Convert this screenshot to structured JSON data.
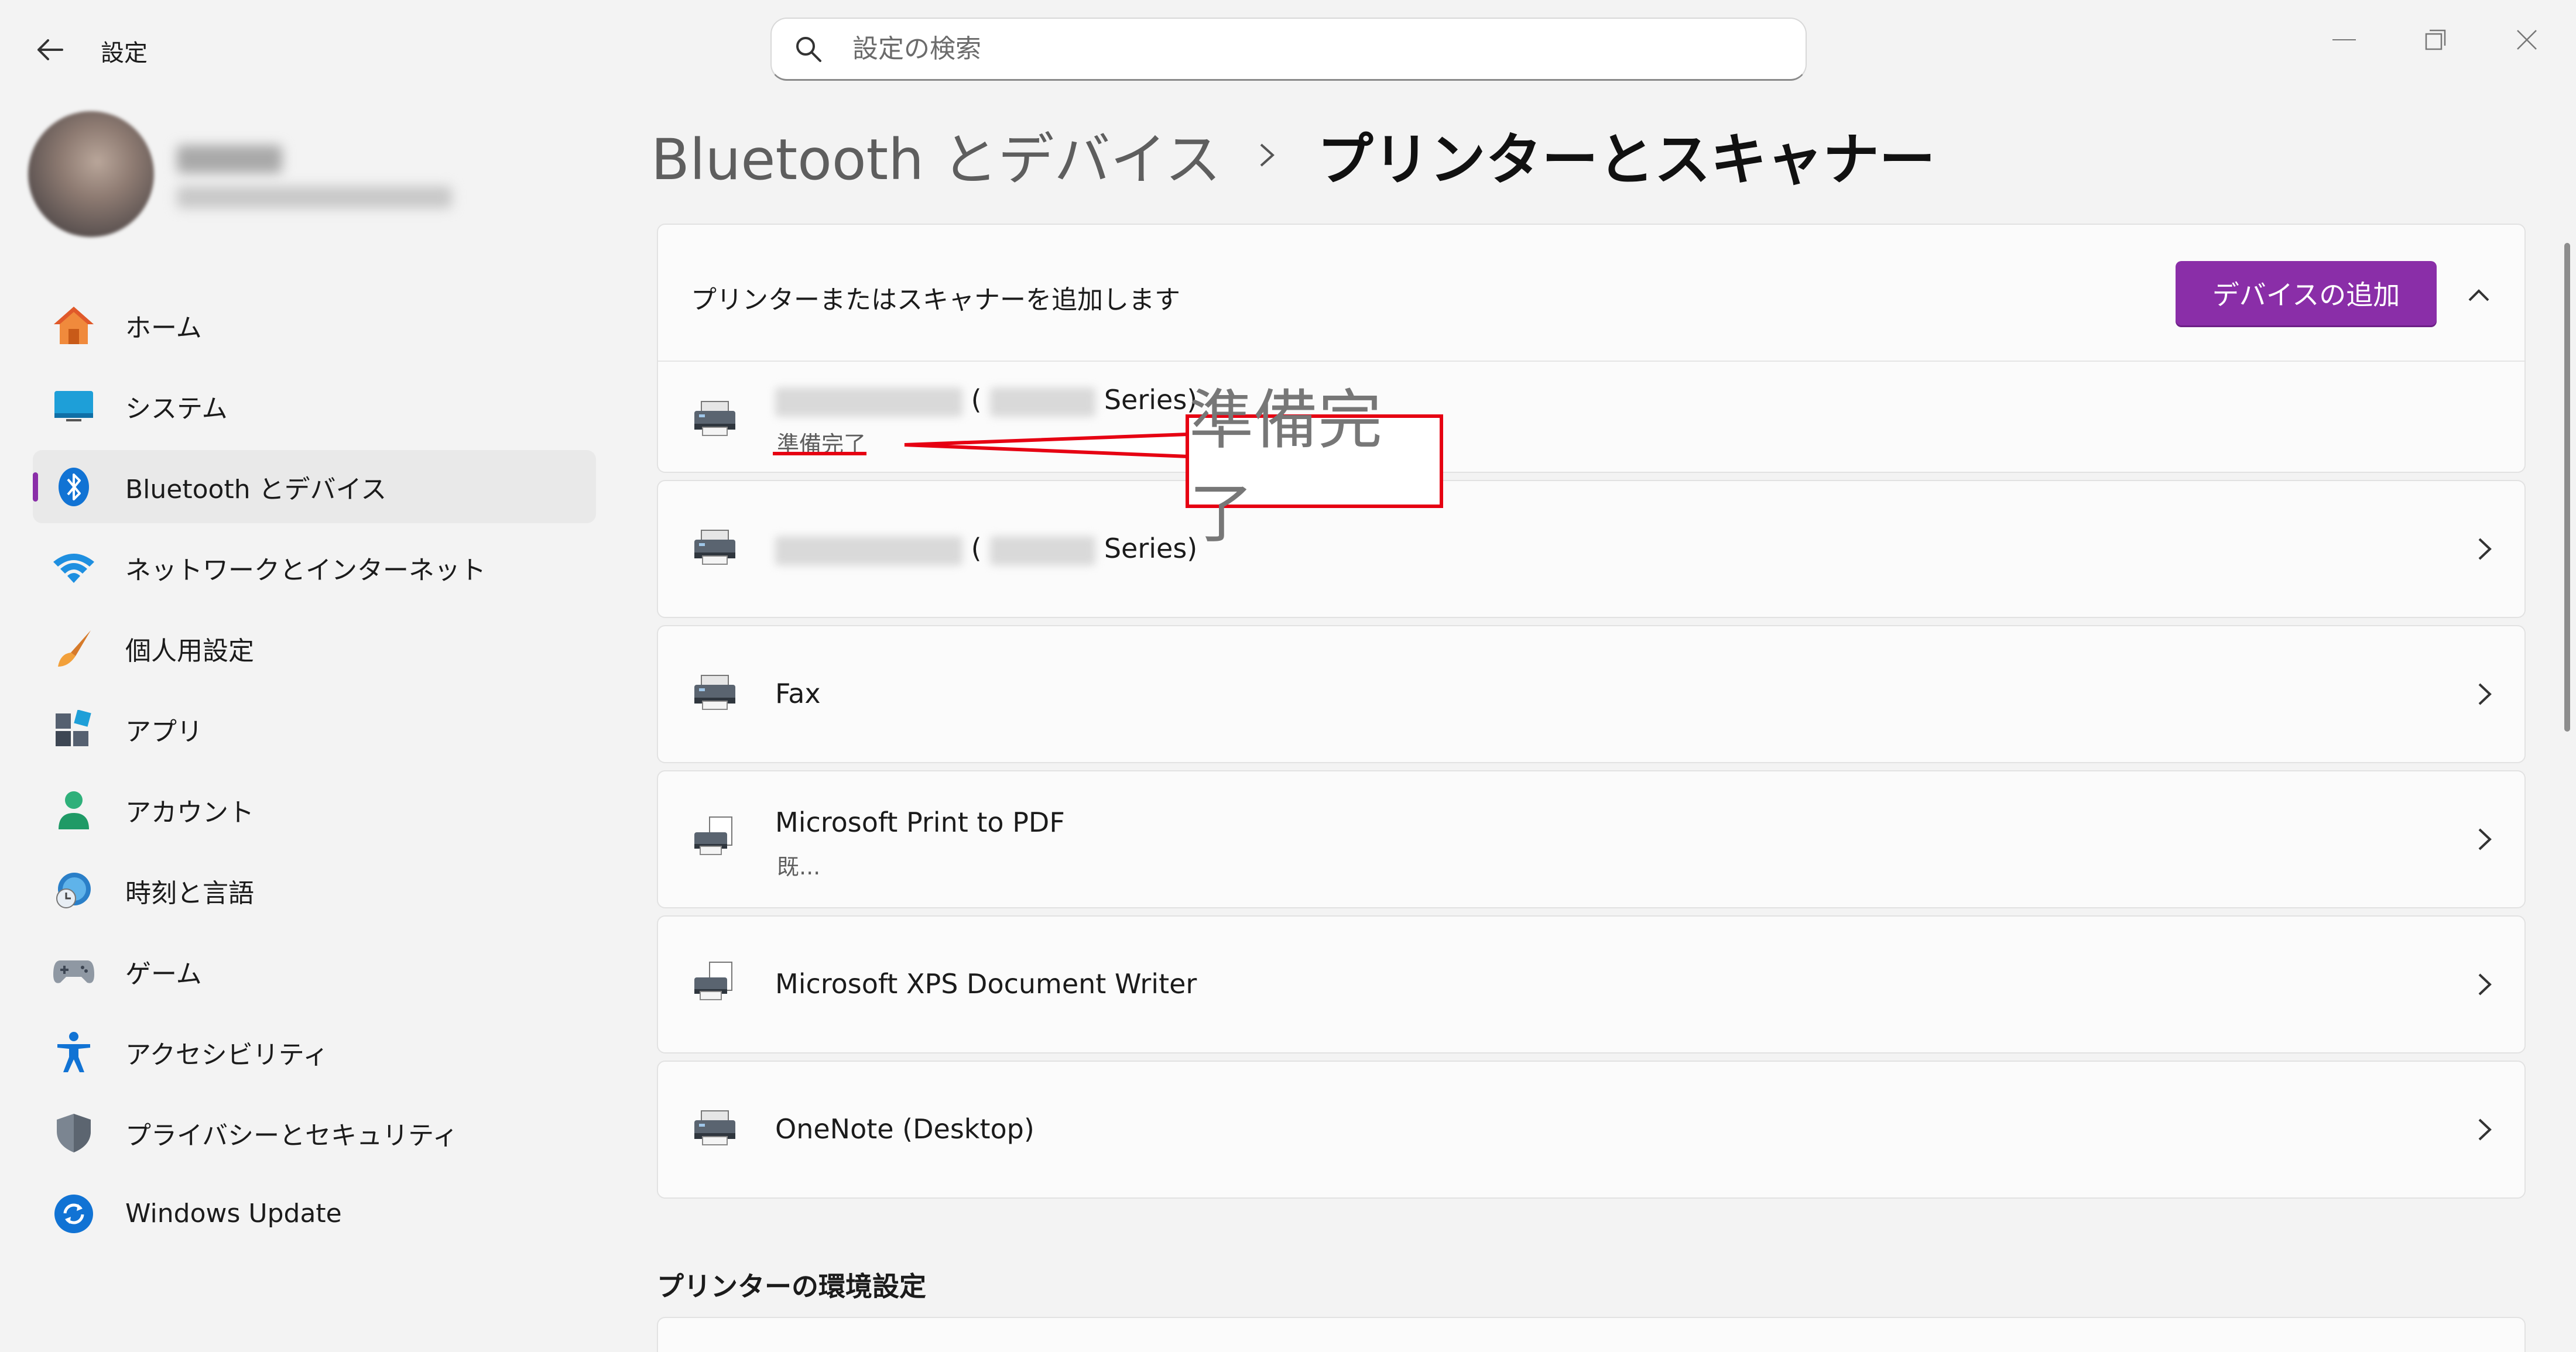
{
  "app": {
    "title": "設定",
    "search_placeholder": "設定の検索"
  },
  "sidebar": {
    "items": [
      {
        "label": "ホーム",
        "icon": "home-icon"
      },
      {
        "label": "システム",
        "icon": "system-icon"
      },
      {
        "label": "Bluetooth とデバイス",
        "icon": "bluetooth-icon",
        "active": true
      },
      {
        "label": "ネットワークとインターネット",
        "icon": "wifi-icon"
      },
      {
        "label": "個人用設定",
        "icon": "brush-icon"
      },
      {
        "label": "アプリ",
        "icon": "apps-icon"
      },
      {
        "label": "アカウント",
        "icon": "account-icon"
      },
      {
        "label": "時刻と言語",
        "icon": "time-language-icon"
      },
      {
        "label": "ゲーム",
        "icon": "gamepad-icon"
      },
      {
        "label": "アクセシビリティ",
        "icon": "accessibility-icon"
      },
      {
        "label": "プライバシーとセキュリティ",
        "icon": "shield-icon"
      },
      {
        "label": "Windows Update",
        "icon": "update-icon"
      }
    ]
  },
  "breadcrumb": {
    "parent": "Bluetooth とデバイス",
    "current": "プリンターとスキャナー"
  },
  "add_section": {
    "text": "プリンターまたはスキャナーを追加します",
    "button": "デバイスの追加"
  },
  "devices": [
    {
      "title_prefix": "(",
      "title_suffix": "Series)",
      "status": "準備完了"
    },
    {
      "title_prefix": "(",
      "title_suffix": "Series)"
    },
    {
      "title": "Fax"
    },
    {
      "title": "Microsoft Print to PDF",
      "status": "既..."
    },
    {
      "title": "Microsoft XPS Document Writer"
    },
    {
      "title": "OneNote (Desktop)"
    }
  ],
  "printer_prefs_title": "プリンターの環境設定",
  "annotation": {
    "text": "準備完了",
    "color": "#e60012"
  },
  "colors": {
    "accent": "#8a2ea8"
  }
}
